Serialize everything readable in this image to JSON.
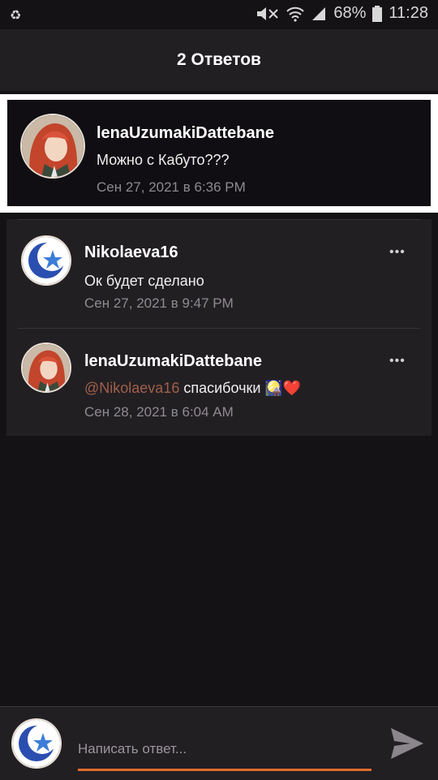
{
  "statusbar": {
    "battery_text": "68%",
    "time": "11:28",
    "icons": [
      "recycle-icon",
      "mute-icon",
      "wifi-icon",
      "signal-icon",
      "battery-icon"
    ]
  },
  "header": {
    "title": "2 Ответов"
  },
  "parent_comment": {
    "author": "lenaUzumakiDattebane",
    "text": "Можно с Кабуто???",
    "timestamp": "Сен 27, 2021 в 6:36 PM"
  },
  "replies": [
    {
      "author": "Nikolaeva16",
      "text": "Ок будет сделано",
      "timestamp": "Сен 27, 2021 в 9:47 PM",
      "more": "•••"
    },
    {
      "author": "lenaUzumakiDattebane",
      "mention": "@Nikolaeva16",
      "text": " спасибочки 🎑❤️",
      "timestamp": "Сен 28, 2021 в 6:04 AM",
      "more": "•••"
    }
  ],
  "compose": {
    "placeholder": "Написать ответ..."
  },
  "colors": {
    "accent": "#e06c2e",
    "mention": "#a0604a",
    "background": "#141215",
    "card": "#221f23"
  }
}
